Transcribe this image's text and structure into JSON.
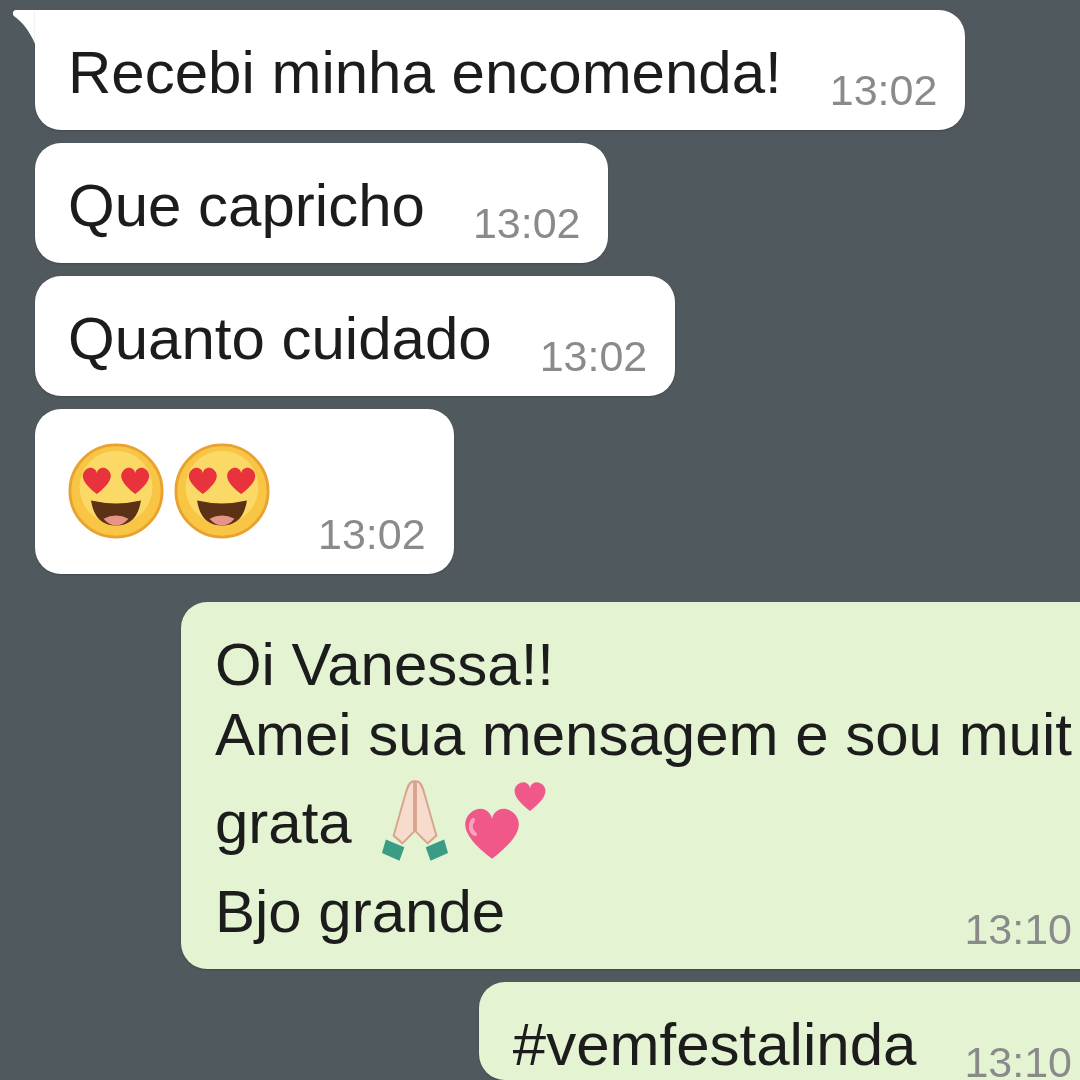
{
  "messages": [
    {
      "kind": "incoming",
      "tail": true,
      "lines": [
        [
          {
            "kind": "text",
            "text": "Recebi minha encomenda!"
          }
        ]
      ],
      "time": "13:02"
    },
    {
      "kind": "incoming",
      "tail": false,
      "lines": [
        [
          {
            "kind": "text",
            "text": "Que capricho"
          }
        ]
      ],
      "time": "13:02"
    },
    {
      "kind": "incoming",
      "tail": false,
      "lines": [
        [
          {
            "kind": "text",
            "text": "Quanto cuidado"
          }
        ]
      ],
      "time": "13:02"
    },
    {
      "kind": "incoming",
      "tail": false,
      "lines": [
        [
          {
            "kind": "hearteyes"
          },
          {
            "kind": "hearteyes"
          }
        ]
      ],
      "time": "13:02"
    },
    {
      "kind": "outgoing",
      "tail": false,
      "lines": [
        [
          {
            "kind": "text",
            "text": "Oi Vanessa!!"
          }
        ],
        [
          {
            "kind": "text",
            "text": "Amei sua mensagem e sou muit"
          }
        ],
        [
          {
            "kind": "text",
            "text": "grata"
          },
          {
            "kind": "pray"
          },
          {
            "kind": "hearts"
          }
        ],
        [
          {
            "kind": "text",
            "text": "Bjo grande"
          }
        ]
      ],
      "time": "13:10"
    },
    {
      "kind": "outgoing",
      "tail": false,
      "lines": [
        [
          {
            "kind": "text",
            "text": "#vemfestalinda"
          }
        ]
      ],
      "time": "13:10"
    }
  ]
}
